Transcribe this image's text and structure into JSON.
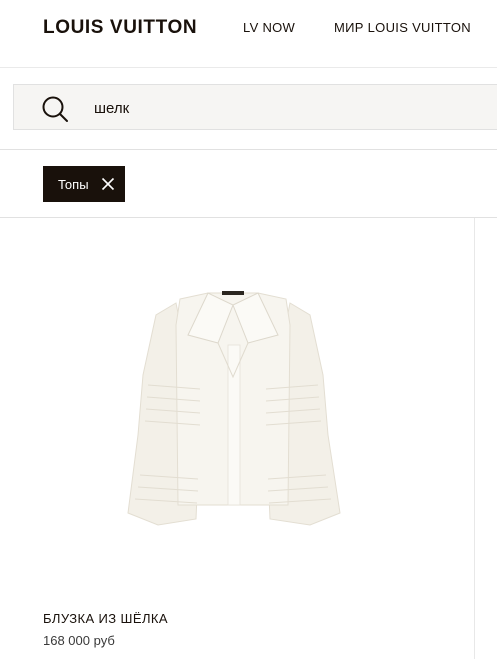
{
  "header": {
    "logo": "LOUIS VUITTON",
    "nav": [
      "LV NOW",
      "МИР LOUIS VUITTON"
    ]
  },
  "search": {
    "query": "шелк",
    "icon": "search-icon"
  },
  "filters": [
    {
      "label": "Топы",
      "icon": "close-icon"
    }
  ],
  "products": [
    {
      "name": "БЛУЗКА ИЗ ШЁЛКА",
      "price": "168 000 руб",
      "image": "silk-blouse-image"
    }
  ],
  "colors": {
    "text": "#19110b",
    "chip_bg": "#19110b",
    "search_bg": "#f6f5f3"
  }
}
